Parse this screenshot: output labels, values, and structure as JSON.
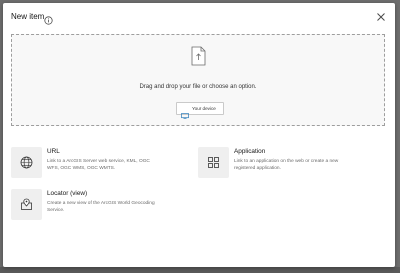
{
  "dialog": {
    "title": "New item",
    "info_icon": "info-icon",
    "close_icon": "close-icon"
  },
  "dropzone": {
    "icon": "file-upload-icon",
    "text": "Drag and drop your file or choose an option.",
    "device_button": {
      "icon": "device-icon",
      "label": "Your device"
    }
  },
  "options": [
    {
      "title": "URL",
      "icon": "globe-icon",
      "description": "Link to a ArcGIS Server web service, KML, OGC WFS, OGC WMS, OGC WMTS."
    },
    {
      "title": "Application",
      "icon": "apps-grid-icon",
      "description": "Link to an application on the web or create a new registered application."
    },
    {
      "title": "Locator (view)",
      "icon": "locator-icon",
      "description": "Create a new view of the ArcGIS World Geocoding Service."
    }
  ],
  "colors": {
    "backdrop": "#6e6e6e",
    "dialog_bg": "#ffffff",
    "dropzone_bg": "#f8f8f8",
    "icon_box": "#efefef"
  }
}
